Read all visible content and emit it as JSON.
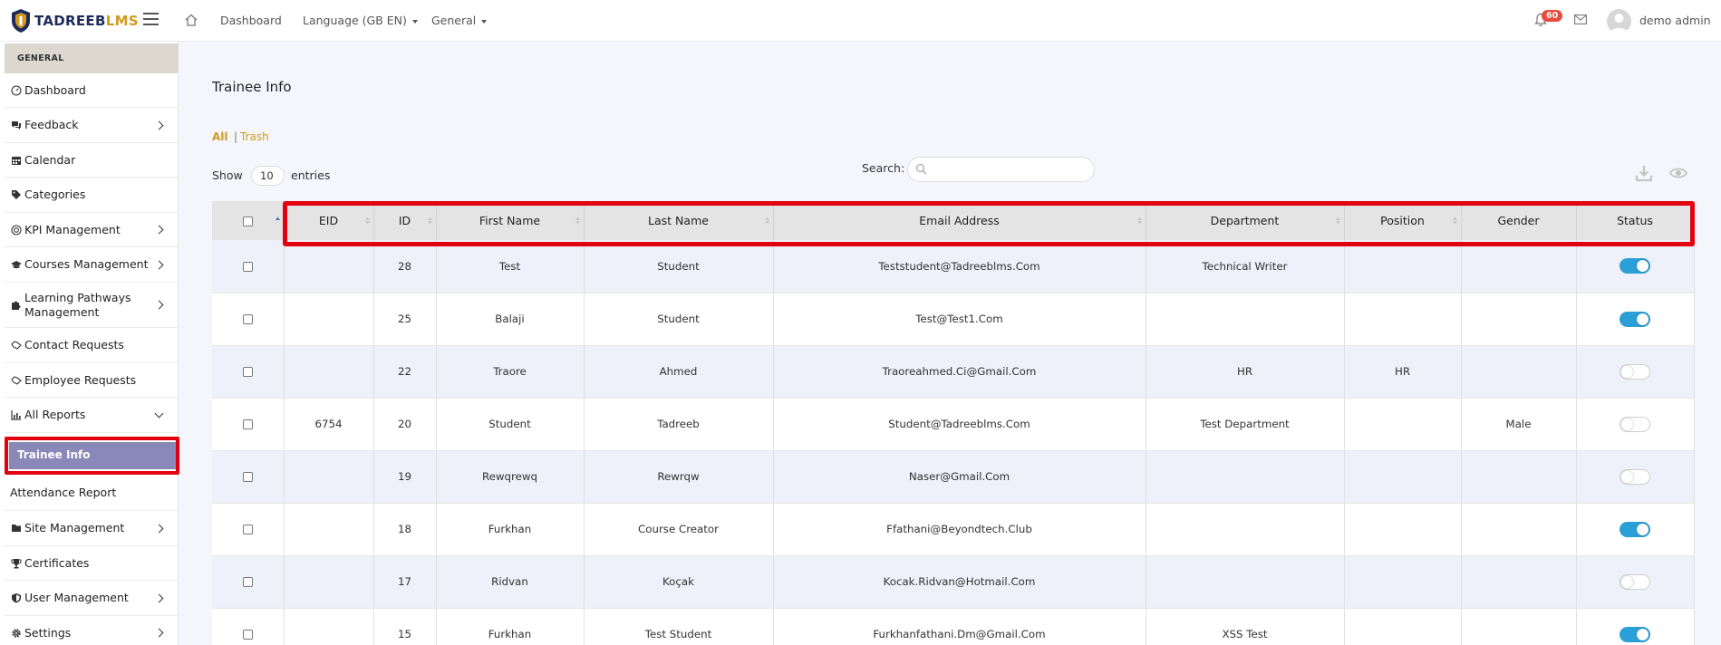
{
  "brand": {
    "part1": "TADREEB",
    "part2": "LMS"
  },
  "topbar": {
    "dashboard": "Dashboard",
    "language": "Language (GB EN)",
    "general": "General",
    "notification_count": "60",
    "user_name": "demo admin"
  },
  "sidebar": {
    "header": "GENERAL",
    "items": [
      {
        "label": "Dashboard",
        "icon": "gauge-icon"
      },
      {
        "label": "Feedback",
        "icon": "comments-icon"
      },
      {
        "label": "Calendar",
        "icon": "calendar-icon"
      },
      {
        "label": "Categories",
        "icon": "tags-icon"
      },
      {
        "label": "KPI Management",
        "icon": "target-icon"
      },
      {
        "label": "Courses Management",
        "icon": "graduation-cap-icon"
      },
      {
        "label": "Learning Pathways Management",
        "icon": "puzzle-icon"
      },
      {
        "label": "Contact Requests",
        "icon": "handshake-icon"
      },
      {
        "label": "Employee Requests",
        "icon": "handshake-icon"
      },
      {
        "label": "All Reports",
        "icon": "bar-chart-icon"
      }
    ],
    "active_item": "Trainee Info",
    "sub_item": "Attendance Report",
    "bottom_items": [
      {
        "label": "Site Management",
        "icon": "folder-icon"
      },
      {
        "label": "Certificates",
        "icon": "trophy-icon"
      },
      {
        "label": "User Management",
        "icon": "shield-icon"
      },
      {
        "label": "Settings",
        "icon": "gear-icon"
      }
    ]
  },
  "main": {
    "title": "Trainee Info",
    "filter_all": "All",
    "filter_separator": "|",
    "filter_trash": "Trash",
    "show_label": "Show",
    "page_length": "10",
    "entries_label": "entries",
    "search_label": "Search:",
    "search_value": ""
  },
  "table": {
    "columns": [
      "EID",
      "ID",
      "First Name",
      "Last Name",
      "Email Address",
      "Department",
      "Position",
      "Gender",
      "Status"
    ],
    "rows": [
      {
        "eid": "",
        "id": "28",
        "first": "Test",
        "last": "Student",
        "email": "Teststudent@Tadreeblms.Com",
        "dept": "Technical Writer",
        "pos": "",
        "gender": "",
        "status": "on"
      },
      {
        "eid": "",
        "id": "25",
        "first": "Balaji",
        "last": "Student",
        "email": "Test@Test1.Com",
        "dept": "",
        "pos": "",
        "gender": "",
        "status": "on"
      },
      {
        "eid": "",
        "id": "22",
        "first": "Traore",
        "last": "Ahmed",
        "email": "Traoreahmed.Ci@Gmail.Com",
        "dept": "HR",
        "pos": "HR",
        "gender": "",
        "status": "off"
      },
      {
        "eid": "6754",
        "id": "20",
        "first": "Student",
        "last": "Tadreeb",
        "email": "Student@Tadreeblms.Com",
        "dept": "Test Department",
        "pos": "",
        "gender": "Male",
        "status": "off"
      },
      {
        "eid": "",
        "id": "19",
        "first": "Rewqrewq",
        "last": "Rewrqw",
        "email": "Naser@Gmail.Com",
        "dept": "",
        "pos": "",
        "gender": "",
        "status": "off"
      },
      {
        "eid": "",
        "id": "18",
        "first": "Furkhan",
        "last": "Course Creator",
        "email": "Ffathani@Beyondtech.Club",
        "dept": "",
        "pos": "",
        "gender": "",
        "status": "on"
      },
      {
        "eid": "",
        "id": "17",
        "first": "Ridvan",
        "last": "Koçak",
        "email": "Kocak.Ridvan@Hotmail.Com",
        "dept": "",
        "pos": "",
        "gender": "",
        "status": "off"
      },
      {
        "eid": "",
        "id": "15",
        "first": "Furkhan",
        "last": "Test Student",
        "email": "Furkhanfathani.Dm@Gmail.Com",
        "dept": "XSS Test",
        "pos": "",
        "gender": "",
        "status": "on"
      }
    ]
  },
  "colors": {
    "accent": "#d09b1f",
    "brand_navy": "#1d2a5b",
    "active_item_bg": "#8a88b8",
    "toggle_on": "#2b9fd8",
    "highlight": "#e3000f"
  }
}
